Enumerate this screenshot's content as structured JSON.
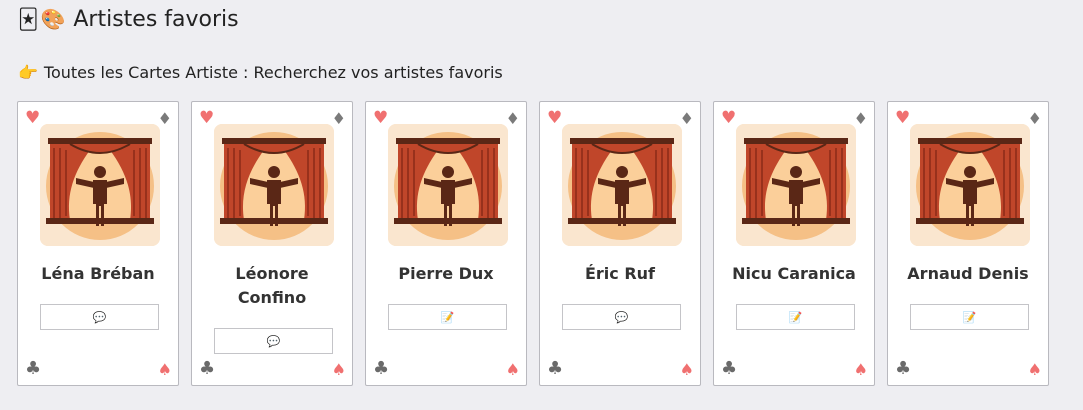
{
  "header": {
    "emoji_jester": "🃏",
    "emoji_palette": "🎨",
    "title": "Artistes favoris"
  },
  "intro": {
    "emoji": "👉",
    "text": "Toutes les Cartes Artiste : Recherchez vos artistes favoris"
  },
  "suits": {
    "top_left": "♥",
    "top_right": "♦",
    "bottom_left": "♣",
    "bottom_right": "♠"
  },
  "avatar_icon": "theater-stage-performer-icon",
  "colors": {
    "avatar_bg": "#fae6cf",
    "curtain": "#c0462a",
    "spotlight": "#f0a04a",
    "figure": "#5a2716",
    "heart": "#f07070",
    "suit_dark": "#7a7a7a"
  },
  "cards": [
    {
      "name": "Léna Bréban",
      "action_icon": "💬",
      "action_icon_name": "speech-bubble-icon",
      "two_line": false
    },
    {
      "name": "Léonore Confino",
      "action_icon": "💬",
      "action_icon_name": "speech-bubble-icon",
      "two_line": true
    },
    {
      "name": "Pierre Dux",
      "action_icon": "📝",
      "action_icon_name": "memo-icon",
      "two_line": false
    },
    {
      "name": "Éric Ruf",
      "action_icon": "💬",
      "action_icon_name": "speech-bubble-icon",
      "two_line": false
    },
    {
      "name": "Nicu Caranica",
      "action_icon": "📝",
      "action_icon_name": "memo-icon",
      "two_line": false
    },
    {
      "name": "Arnaud Denis",
      "action_icon": "📝",
      "action_icon_name": "memo-icon",
      "two_line": false
    }
  ]
}
